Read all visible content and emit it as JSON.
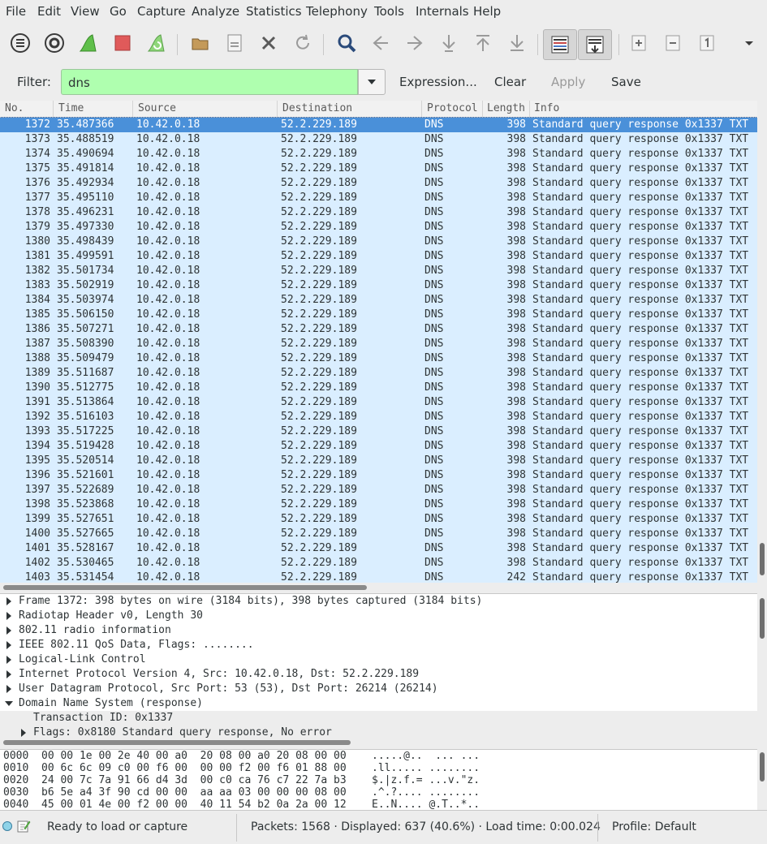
{
  "menu": [
    "File",
    "Edit",
    "View",
    "Go",
    "Capture",
    "Analyze",
    "Statistics",
    "Telephony",
    "Tools",
    "Internals",
    "Help"
  ],
  "toolbar": {
    "icons": [
      "interfaces-icon",
      "capture-options-icon",
      "start-capture-icon",
      "stop-capture-icon",
      "restart-capture-icon",
      "open-file-icon",
      "save-file-icon",
      "close-file-icon",
      "reload-icon",
      "find-icon",
      "go-back-icon",
      "go-forward-icon",
      "go-to-packet-icon",
      "first-packet-icon",
      "last-packet-icon",
      "colorize-icon",
      "autoscroll-icon",
      "zoom-in-icon",
      "zoom-out-icon",
      "normal-size-icon",
      "more-icon"
    ]
  },
  "filter": {
    "label": "Filter:",
    "value": "dns",
    "color": "#afffaf",
    "expression": "Expression...",
    "clear": "Clear",
    "apply": "Apply",
    "save": "Save"
  },
  "packet_list": {
    "columns": [
      "No.",
      "Time",
      "Source",
      "Destination",
      "Protocol",
      "Length",
      "Info"
    ],
    "rows": [
      {
        "no": "1372",
        "time": "35.487366",
        "src": "10.42.0.18",
        "dst": "52.2.229.189",
        "proto": "DNS",
        "len": "398",
        "info": "Standard query response 0x1337 TXT"
      },
      {
        "no": "1373",
        "time": "35.488519",
        "src": "10.42.0.18",
        "dst": "52.2.229.189",
        "proto": "DNS",
        "len": "398",
        "info": "Standard query response 0x1337 TXT"
      },
      {
        "no": "1374",
        "time": "35.490694",
        "src": "10.42.0.18",
        "dst": "52.2.229.189",
        "proto": "DNS",
        "len": "398",
        "info": "Standard query response 0x1337 TXT"
      },
      {
        "no": "1375",
        "time": "35.491814",
        "src": "10.42.0.18",
        "dst": "52.2.229.189",
        "proto": "DNS",
        "len": "398",
        "info": "Standard query response 0x1337 TXT"
      },
      {
        "no": "1376",
        "time": "35.492934",
        "src": "10.42.0.18",
        "dst": "52.2.229.189",
        "proto": "DNS",
        "len": "398",
        "info": "Standard query response 0x1337 TXT"
      },
      {
        "no": "1377",
        "time": "35.495110",
        "src": "10.42.0.18",
        "dst": "52.2.229.189",
        "proto": "DNS",
        "len": "398",
        "info": "Standard query response 0x1337 TXT"
      },
      {
        "no": "1378",
        "time": "35.496231",
        "src": "10.42.0.18",
        "dst": "52.2.229.189",
        "proto": "DNS",
        "len": "398",
        "info": "Standard query response 0x1337 TXT"
      },
      {
        "no": "1379",
        "time": "35.497330",
        "src": "10.42.0.18",
        "dst": "52.2.229.189",
        "proto": "DNS",
        "len": "398",
        "info": "Standard query response 0x1337 TXT"
      },
      {
        "no": "1380",
        "time": "35.498439",
        "src": "10.42.0.18",
        "dst": "52.2.229.189",
        "proto": "DNS",
        "len": "398",
        "info": "Standard query response 0x1337 TXT"
      },
      {
        "no": "1381",
        "time": "35.499591",
        "src": "10.42.0.18",
        "dst": "52.2.229.189",
        "proto": "DNS",
        "len": "398",
        "info": "Standard query response 0x1337 TXT"
      },
      {
        "no": "1382",
        "time": "35.501734",
        "src": "10.42.0.18",
        "dst": "52.2.229.189",
        "proto": "DNS",
        "len": "398",
        "info": "Standard query response 0x1337 TXT"
      },
      {
        "no": "1383",
        "time": "35.502919",
        "src": "10.42.0.18",
        "dst": "52.2.229.189",
        "proto": "DNS",
        "len": "398",
        "info": "Standard query response 0x1337 TXT"
      },
      {
        "no": "1384",
        "time": "35.503974",
        "src": "10.42.0.18",
        "dst": "52.2.229.189",
        "proto": "DNS",
        "len": "398",
        "info": "Standard query response 0x1337 TXT"
      },
      {
        "no": "1385",
        "time": "35.506150",
        "src": "10.42.0.18",
        "dst": "52.2.229.189",
        "proto": "DNS",
        "len": "398",
        "info": "Standard query response 0x1337 TXT"
      },
      {
        "no": "1386",
        "time": "35.507271",
        "src": "10.42.0.18",
        "dst": "52.2.229.189",
        "proto": "DNS",
        "len": "398",
        "info": "Standard query response 0x1337 TXT"
      },
      {
        "no": "1387",
        "time": "35.508390",
        "src": "10.42.0.18",
        "dst": "52.2.229.189",
        "proto": "DNS",
        "len": "398",
        "info": "Standard query response 0x1337 TXT"
      },
      {
        "no": "1388",
        "time": "35.509479",
        "src": "10.42.0.18",
        "dst": "52.2.229.189",
        "proto": "DNS",
        "len": "398",
        "info": "Standard query response 0x1337 TXT"
      },
      {
        "no": "1389",
        "time": "35.511687",
        "src": "10.42.0.18",
        "dst": "52.2.229.189",
        "proto": "DNS",
        "len": "398",
        "info": "Standard query response 0x1337 TXT"
      },
      {
        "no": "1390",
        "time": "35.512775",
        "src": "10.42.0.18",
        "dst": "52.2.229.189",
        "proto": "DNS",
        "len": "398",
        "info": "Standard query response 0x1337 TXT"
      },
      {
        "no": "1391",
        "time": "35.513864",
        "src": "10.42.0.18",
        "dst": "52.2.229.189",
        "proto": "DNS",
        "len": "398",
        "info": "Standard query response 0x1337 TXT"
      },
      {
        "no": "1392",
        "time": "35.516103",
        "src": "10.42.0.18",
        "dst": "52.2.229.189",
        "proto": "DNS",
        "len": "398",
        "info": "Standard query response 0x1337 TXT"
      },
      {
        "no": "1393",
        "time": "35.517225",
        "src": "10.42.0.18",
        "dst": "52.2.229.189",
        "proto": "DNS",
        "len": "398",
        "info": "Standard query response 0x1337 TXT"
      },
      {
        "no": "1394",
        "time": "35.519428",
        "src": "10.42.0.18",
        "dst": "52.2.229.189",
        "proto": "DNS",
        "len": "398",
        "info": "Standard query response 0x1337 TXT"
      },
      {
        "no": "1395",
        "time": "35.520514",
        "src": "10.42.0.18",
        "dst": "52.2.229.189",
        "proto": "DNS",
        "len": "398",
        "info": "Standard query response 0x1337 TXT"
      },
      {
        "no": "1396",
        "time": "35.521601",
        "src": "10.42.0.18",
        "dst": "52.2.229.189",
        "proto": "DNS",
        "len": "398",
        "info": "Standard query response 0x1337 TXT"
      },
      {
        "no": "1397",
        "time": "35.522689",
        "src": "10.42.0.18",
        "dst": "52.2.229.189",
        "proto": "DNS",
        "len": "398",
        "info": "Standard query response 0x1337 TXT"
      },
      {
        "no": "1398",
        "time": "35.523868",
        "src": "10.42.0.18",
        "dst": "52.2.229.189",
        "proto": "DNS",
        "len": "398",
        "info": "Standard query response 0x1337 TXT"
      },
      {
        "no": "1399",
        "time": "35.527651",
        "src": "10.42.0.18",
        "dst": "52.2.229.189",
        "proto": "DNS",
        "len": "398",
        "info": "Standard query response 0x1337 TXT"
      },
      {
        "no": "1400",
        "time": "35.527665",
        "src": "10.42.0.18",
        "dst": "52.2.229.189",
        "proto": "DNS",
        "len": "398",
        "info": "Standard query response 0x1337 TXT"
      },
      {
        "no": "1401",
        "time": "35.528167",
        "src": "10.42.0.18",
        "dst": "52.2.229.189",
        "proto": "DNS",
        "len": "398",
        "info": "Standard query response 0x1337 TXT"
      },
      {
        "no": "1402",
        "time": "35.530465",
        "src": "10.42.0.18",
        "dst": "52.2.229.189",
        "proto": "DNS",
        "len": "398",
        "info": "Standard query response 0x1337 TXT"
      },
      {
        "no": "1403",
        "time": "35.531454",
        "src": "10.42.0.18",
        "dst": "52.2.229.189",
        "proto": "DNS",
        "len": "242",
        "info": "Standard query response 0x1337 TXT"
      }
    ],
    "row_color": "#daeeff",
    "selected_color": "#4a90d9"
  },
  "details": [
    {
      "text": "Frame 1372: 398 bytes on wire (3184 bits), 398 bytes captured (3184 bits)",
      "state": "collapsed",
      "level": 0
    },
    {
      "text": "Radiotap Header v0, Length 30",
      "state": "collapsed",
      "level": 0
    },
    {
      "text": "802.11 radio information",
      "state": "collapsed",
      "level": 0
    },
    {
      "text": "IEEE 802.11 QoS Data, Flags: ........",
      "state": "collapsed",
      "level": 0
    },
    {
      "text": "Logical-Link Control",
      "state": "collapsed",
      "level": 0
    },
    {
      "text": "Internet Protocol Version 4, Src: 10.42.0.18, Dst: 52.2.229.189",
      "state": "collapsed",
      "level": 0
    },
    {
      "text": "User Datagram Protocol, Src Port: 53 (53), Dst Port: 26214 (26214)",
      "state": "collapsed",
      "level": 0
    },
    {
      "text": "Domain Name System (response)",
      "state": "expanded",
      "level": 0
    },
    {
      "text": "Transaction ID: 0x1337",
      "state": "leaf",
      "level": 1
    },
    {
      "text": "Flags: 0x8180 Standard query response, No error",
      "state": "collapsed",
      "level": 1
    }
  ],
  "bytes": [
    {
      "off": "0000",
      "hex": "00 00 1e 00 2e 40 00 a0  20 08 00 a0 20 08 00 00",
      "ascii": ".....@..  ... ..."
    },
    {
      "off": "0010",
      "hex": "00 6c 6c 09 c0 00 f6 00  00 00 f2 00 f6 01 88 00",
      "ascii": ".ll..... ........"
    },
    {
      "off": "0020",
      "hex": "24 00 7c 7a 91 66 d4 3d  00 c0 ca 76 c7 22 7a b3",
      "ascii": "$.|z.f.= ...v.\"z."
    },
    {
      "off": "0030",
      "hex": "b6 5e a4 3f 90 cd 00 00  aa aa 03 00 00 00 08 00",
      "ascii": ".^.?.... ........"
    },
    {
      "off": "0040",
      "hex": "45 00 01 4e 00 f2 00 00  40 11 54 b2 0a 2a 00 12",
      "ascii": "E..N.... @.T..*.."
    }
  ],
  "status": {
    "ready": "Ready to load or capture",
    "packets": "Packets: 1568 · Displayed: 637 (40.6%) · Load time: 0:00.024",
    "profile": "Profile: Default"
  }
}
